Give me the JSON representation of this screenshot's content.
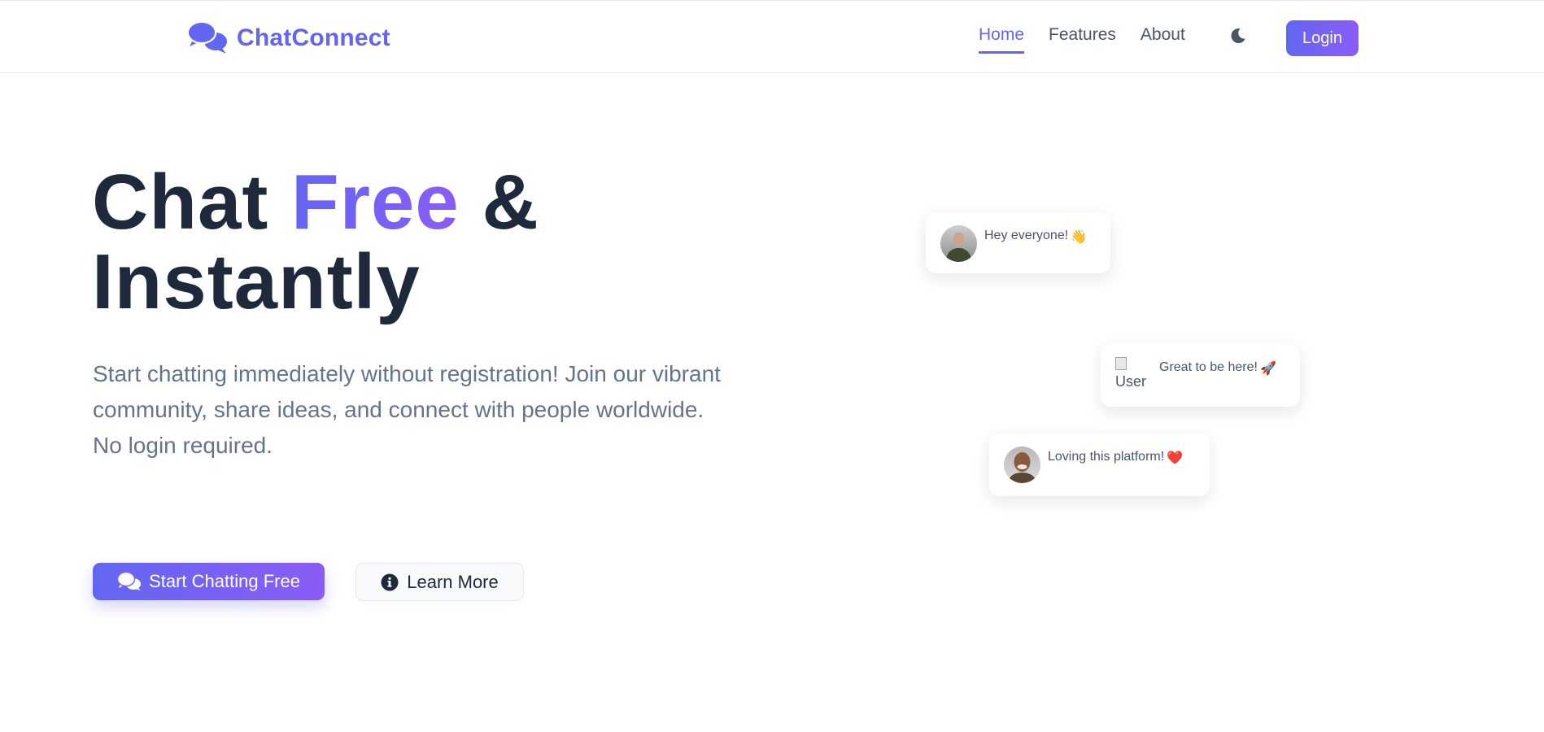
{
  "brand": {
    "name": "ChatConnect",
    "icon": "comments-icon",
    "color": "#6366f1"
  },
  "nav": {
    "links": [
      {
        "label": "Home",
        "active": true
      },
      {
        "label": "Features",
        "active": false
      },
      {
        "label": "About",
        "active": false
      }
    ],
    "theme_icon": "moon-icon",
    "login_label": "Login"
  },
  "hero": {
    "title_part1": "Chat ",
    "title_accent": "Free",
    "title_part2": " &",
    "title_line2": "Instantly",
    "subtitle": "Start chatting immediately without registration! Join our vibrant community, share ideas, and connect with people worldwide. No login required.",
    "primary_button": {
      "label": "Start Chatting Free",
      "icon": "comments-icon"
    },
    "secondary_button": {
      "label": "Learn More",
      "icon": "info-circle-icon"
    }
  },
  "bubbles": [
    {
      "text": "Hey everyone!",
      "emoji": "👋",
      "avatar": "avatar-man-1"
    },
    {
      "text": "Great to be here!",
      "emoji": "🚀",
      "avatar_alt": "User"
    },
    {
      "text": "Loving this platform!",
      "emoji": "❤️",
      "avatar": "avatar-man-2"
    }
  ],
  "colors": {
    "accent": "#6366f1",
    "accent_end": "#8b5cf6",
    "heading": "#1e293b",
    "muted": "#64748b"
  }
}
